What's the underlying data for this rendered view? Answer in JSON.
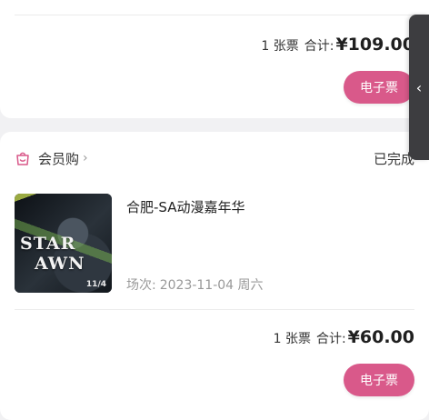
{
  "order_top": {
    "ticket_count": "1 张票",
    "total_label": "合计:",
    "total_amount": "¥109.00",
    "button_label": "电子票"
  },
  "side_handle": {
    "icon": "chevron-left-icon",
    "glyph": "‹"
  },
  "order_bottom": {
    "member_icon": "shopping-bag-icon",
    "member_label": "会员购",
    "member_chevron": "›",
    "status": "已完成",
    "poster": {
      "title_line1": "STAR",
      "title_line2": "AWN",
      "date": "11/4"
    },
    "event_title": "合肥-SA动漫嘉年华",
    "session_label": "场次:",
    "session_value": "2023-11-04 周六",
    "ticket_count": "1 张票",
    "total_label": "合计:",
    "total_amount": "¥60.00",
    "button_label": "电子票"
  },
  "colors": {
    "accent": "#d9598a",
    "background": "#f1f1f3",
    "card": "#ffffff",
    "handle": "#3d3d40"
  }
}
